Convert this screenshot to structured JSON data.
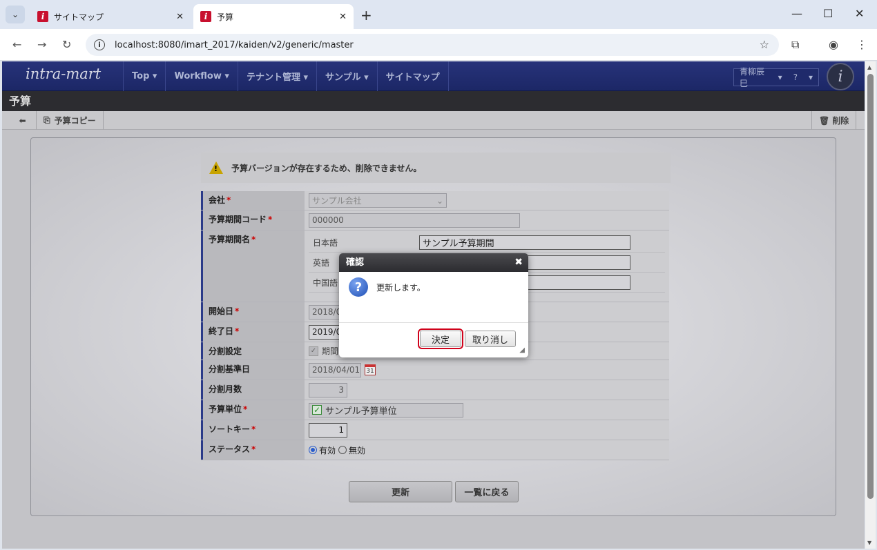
{
  "browser": {
    "tabs": [
      {
        "title": "サイトマップ",
        "favicon": "i"
      },
      {
        "title": "予算",
        "favicon": "i"
      }
    ],
    "url": "localhost:8080/imart_2017/kaiden/v2/generic/master"
  },
  "app": {
    "logo": "intra-mart",
    "menu": [
      "Top ▾",
      "Workflow ▾",
      "テナント管理 ▾",
      "サンプル ▾",
      "サイトマップ"
    ],
    "user": "青柳辰巳",
    "help": "?",
    "page_title": "予算",
    "toolbar": {
      "copy": "予算コピー",
      "delete": "削除"
    }
  },
  "warning": "予算バージョンが存在するため、削除できません。",
  "form": {
    "company": {
      "label": "会社",
      "value": "サンプル会社"
    },
    "period_code": {
      "label": "予算期間コード",
      "value": "000000"
    },
    "period_name": {
      "label": "予算期間名",
      "langs": [
        {
          "lang": "日本語",
          "value": "サンプル予算期間"
        },
        {
          "lang": "英語",
          "value": ""
        },
        {
          "lang": "中国語",
          "value": ""
        }
      ]
    },
    "start_date": {
      "label": "開始日",
      "value": "2018/0"
    },
    "end_date": {
      "label": "終了日",
      "value": "2019/0"
    },
    "split": {
      "label": "分割設定",
      "value": "期間"
    },
    "split_base": {
      "label": "分割基準日",
      "value": "2018/04/01"
    },
    "split_months": {
      "label": "分割月数",
      "value": "3"
    },
    "budget_unit": {
      "label": "予算単位",
      "value": "サンプル予算単位"
    },
    "sort_key": {
      "label": "ソートキー",
      "value": "1"
    },
    "status": {
      "label": "ステータス",
      "on": "有効",
      "off": "無効"
    },
    "required_mark": "*"
  },
  "buttons": {
    "update": "更新",
    "back": "一覧に戻る"
  },
  "dialog": {
    "title": "確認",
    "message": "更新します。",
    "ok": "決定",
    "cancel": "取り消し"
  }
}
